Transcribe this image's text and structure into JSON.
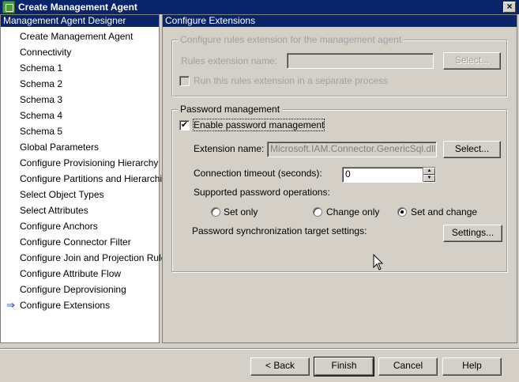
{
  "window": {
    "title": "Create Management Agent",
    "close_glyph": "×"
  },
  "sidebar": {
    "header": "Management Agent Designer",
    "items": [
      {
        "label": "Create Management Agent"
      },
      {
        "label": "Connectivity"
      },
      {
        "label": "Schema 1"
      },
      {
        "label": "Schema 2"
      },
      {
        "label": "Schema 3"
      },
      {
        "label": "Schema 4"
      },
      {
        "label": "Schema 5"
      },
      {
        "label": "Global Parameters"
      },
      {
        "label": "Configure Provisioning Hierarchy"
      },
      {
        "label": "Configure Partitions and Hierarchies"
      },
      {
        "label": "Select Object Types"
      },
      {
        "label": "Select Attributes"
      },
      {
        "label": "Configure Anchors"
      },
      {
        "label": "Configure Connector Filter"
      },
      {
        "label": "Configure Join and Projection Rules"
      },
      {
        "label": "Configure Attribute Flow"
      },
      {
        "label": "Configure Deprovisioning"
      },
      {
        "label": "Configure Extensions",
        "current_marker": "⇒"
      }
    ]
  },
  "main": {
    "header": "Configure Extensions",
    "rules_extension": {
      "legend": "Configure rules extension for the management agent",
      "name_label": "Rules extension name:",
      "name_value": "",
      "select_button": "Select...",
      "run_separate_label": "Run this rules extension in a separate process",
      "run_separate_checked": false
    },
    "password": {
      "legend": "Password management",
      "enable_label": "Enable password management",
      "enable_checked": true,
      "check_glyph": "✔",
      "extension_label": "Extension name:",
      "extension_value": "Microsoft.IAM.Connector.GenericSql.dll",
      "select_button": "Select...",
      "timeout_label": "Connection timeout (seconds):",
      "timeout_value": "0",
      "spin_up": "▲",
      "spin_down": "▼",
      "operations_label": "Supported password operations:",
      "operations": [
        {
          "label": "Set only",
          "selected": false
        },
        {
          "label": "Change only",
          "selected": false
        },
        {
          "label": "Set and change",
          "selected": true
        }
      ],
      "sync_label": "Password synchronization target settings:",
      "settings_button": "Settings..."
    }
  },
  "footer": {
    "back": "< Back",
    "finish": "Finish",
    "cancel": "Cancel",
    "help": "Help"
  }
}
